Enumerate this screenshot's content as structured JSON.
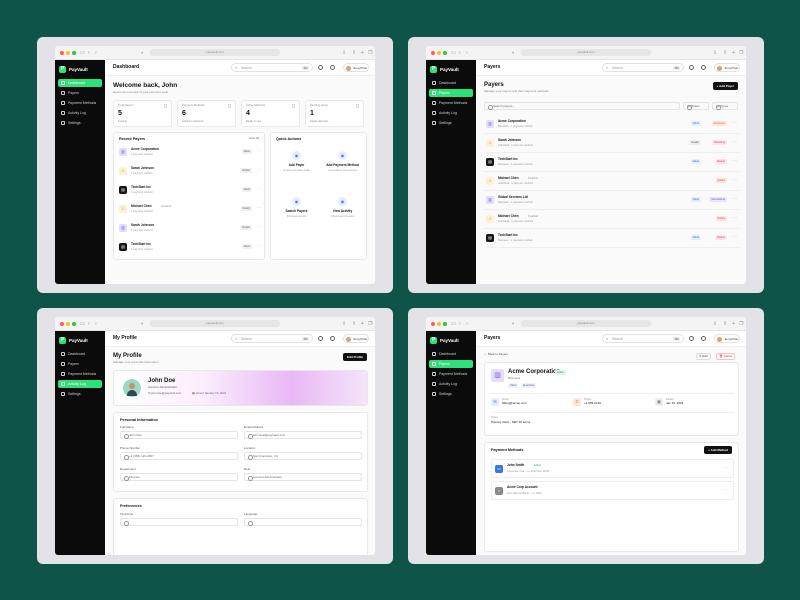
{
  "app": {
    "name": "PayVault",
    "url": "payvault.com",
    "search_placeholder": "Search",
    "search_shortcut": "⌘K",
    "user_name": "Jung Prian",
    "nav": [
      "Dashboard",
      "Payers",
      "Payment Methods",
      "Activity Log",
      "Settings"
    ]
  },
  "colors": {
    "brand": "#2ee07a",
    "sidebar": "#0b0b0b",
    "background": "#0e5449"
  },
  "dashboard": {
    "title": "Dashboard",
    "welcome": "Welcome back, John",
    "welcome_sub": "Here's an overview of your payment vault",
    "stats": [
      {
        "label": "Total Payers",
        "value": "5",
        "sub": "5 active"
      },
      {
        "label": "Payment Methods",
        "value": "6",
        "sub": "Linked to accounts"
      },
      {
        "label": "Active Methods",
        "value": "4",
        "sub": "Ready to use"
      },
      {
        "label": "Pending Items",
        "value": "1",
        "sub": "Needs attention"
      }
    ],
    "recent_title": "Recent Payers",
    "view_all": "View all",
    "recent": [
      {
        "name": "Acme Corporation",
        "sub": "1 payment method",
        "badge": "Client",
        "type": "biz"
      },
      {
        "name": "Sarah Johnson",
        "sub": "1 payment method",
        "badge": "Vendor",
        "type": "ind"
      },
      {
        "name": "TechStart Inc",
        "sub": "1 payment method",
        "badge": "Client",
        "type": "dark"
      },
      {
        "name": "Michael Chen",
        "sub": "1 payment method",
        "badge": "Family",
        "type": "ind",
        "tag": "Disabled"
      },
      {
        "name": "Sarah Johnson",
        "sub": "1 payment method",
        "badge": "Vendor",
        "type": "biz"
      },
      {
        "name": "TechStart Inc",
        "sub": "1 payment method",
        "badge": "Client",
        "type": "dark"
      }
    ],
    "quick_title": "Quick Actions",
    "quick": [
      {
        "title": "Add Payer",
        "sub": "Create a new payer profile"
      },
      {
        "title": "Add Payment Method",
        "sub": "Link a card or bank account"
      },
      {
        "title": "Search Payers",
        "sub": "Find payer records"
      },
      {
        "title": "View Activity",
        "sub": "Check recent changes"
      }
    ]
  },
  "payers": {
    "title": "Payers",
    "heading": "Payers",
    "sub": "Manage your payers and their payment methods",
    "add": "Add Payer",
    "search_placeholder": "Search payers...",
    "filter_status": "All Status",
    "filter_types": "All Types",
    "rows": [
      {
        "name": "Acme Corporation",
        "sub": "Business · 1 payment method",
        "badge1": "Client",
        "badge2": "Enterprise",
        "type": "biz",
        "c1": "blue",
        "c2": "orange"
      },
      {
        "name": "Sarah Johnson",
        "sub": "Individual · 1 payment method",
        "badge1": "Vendor",
        "badge2": "Marketing",
        "type": "ind",
        "c1": "gray",
        "c2": "pink"
      },
      {
        "name": "TechStart Inc",
        "sub": "Business · 1 payment method",
        "badge1": "Client",
        "badge2": "Startup",
        "type": "dark",
        "c1": "blue",
        "c2": "pink"
      },
      {
        "name": "Michael Chen",
        "sub": "Individual · 1 payment method",
        "badge1": "",
        "badge2": "Family",
        "type": "ind",
        "tag": "Disabled",
        "c1": "",
        "c2": "red"
      },
      {
        "name": "Global Services Ltd",
        "sub": "Business · 1 payment method",
        "badge1": "Client",
        "badge2": "International",
        "type": "biz",
        "c1": "blue",
        "c2": "purple"
      },
      {
        "name": "Michael Chen",
        "sub": "Individual · 1 payment method",
        "badge1": "",
        "badge2": "Family",
        "type": "ind",
        "tag": "Disabled",
        "c1": "",
        "c2": "red"
      },
      {
        "name": "TechStart Inc",
        "sub": "Business · 1 payment method",
        "badge1": "Client",
        "badge2": "Startup",
        "type": "dark",
        "c1": "blue",
        "c2": "pink"
      }
    ]
  },
  "profile": {
    "title": "My Profile",
    "heading": "My Profile",
    "sub": "Manage your personal information",
    "edit": "Edit Profile",
    "name": "John Doe",
    "role": "Account Administrator",
    "email": "john.doe@payvault.com",
    "joined": "Joined January 15, 2024",
    "personal_title": "Personal Information",
    "fields": [
      {
        "label": "Full Name",
        "value": "John Doe"
      },
      {
        "label": "Email Address",
        "value": "john.doe@payvault.com"
      },
      {
        "label": "Phone Number",
        "value": "+1 (555) 123-4567"
      },
      {
        "label": "Location",
        "value": "San Francisco, CA"
      },
      {
        "label": "Department",
        "value": "Finance"
      },
      {
        "label": "Role",
        "value": "Account Administrator"
      }
    ],
    "pref_title": "Preferences",
    "pref_fields": [
      "Timezone",
      "Language"
    ]
  },
  "detail": {
    "title": "Payers",
    "back": "Back to Payers",
    "edit": "Edit",
    "delete": "Delete",
    "name": "Acme Corporation",
    "status": "Active",
    "type": "Business",
    "tags": [
      "Client",
      "Enterprise"
    ],
    "email_label": "Email",
    "email": "billing@acme.com",
    "phone_label": "Phone",
    "phone": "+1 555-0199",
    "added_label": "Added",
    "added": "Jan 15, 2024",
    "notes_label": "Notes",
    "notes": "Primary client - NET 30 terms",
    "pm_title": "Payment Methods",
    "add_method": "Add Method",
    "methods": [
      {
        "name": "John Smith",
        "status": "Active",
        "sub": "Corporate Visa · •••• 4242 Exp 12/26",
        "kind": "card"
      },
      {
        "name": "Acme Corp Account",
        "status": "",
        "sub": "First National Bank · •••• 7890",
        "kind": "bank"
      }
    ]
  }
}
